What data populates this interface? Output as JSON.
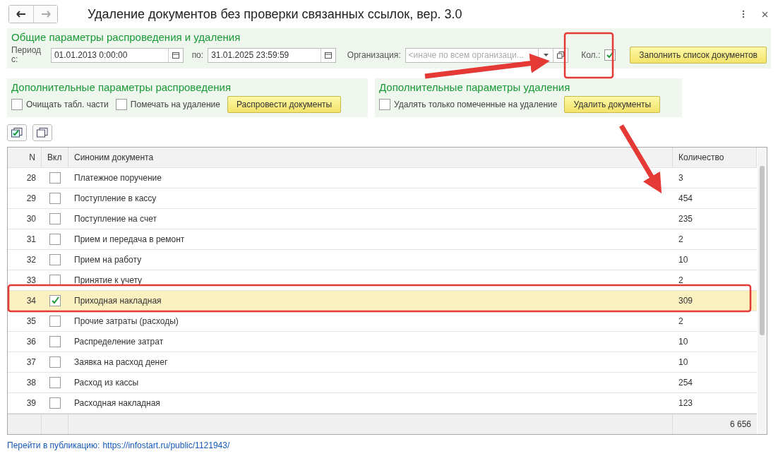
{
  "window": {
    "title": "Удаление документов без проверки связанных ссылок, вер. 3.0"
  },
  "general": {
    "title": "Общие параметры распроведения и удаления",
    "period_label": "Период с:",
    "date_from": "01.01.2013  0:00:00",
    "to_label": "по:",
    "date_to": "31.01.2025 23:59:59",
    "org_label": "Организация:",
    "org_placeholder": "<иначе по всем организаци...",
    "count_label": "Кол.:",
    "count_checked": true,
    "fill_button": "Заполнить список документов"
  },
  "repost": {
    "title": "Дополнительные параметры распроведения",
    "options": [
      {
        "label": "Очищать табл. части",
        "checked": false
      },
      {
        "label": "Помечать на удаление",
        "checked": false
      }
    ],
    "button": "Распровести документы"
  },
  "delete": {
    "title": "Дополнительные параметры удаления",
    "options": [
      {
        "label": "Удалять только помеченные на удаление",
        "checked": false
      }
    ],
    "button": "Удалить документы"
  },
  "table": {
    "columns": [
      "N",
      "Вкл",
      "Синоним документа",
      "Количество"
    ],
    "rows": [
      {
        "n": "28",
        "checked": false,
        "name": "Платежное поручение",
        "count": "3",
        "selected": false
      },
      {
        "n": "29",
        "checked": false,
        "name": "Поступление в кассу",
        "count": "454",
        "selected": false
      },
      {
        "n": "30",
        "checked": false,
        "name": "Поступление на счет",
        "count": "235",
        "selected": false
      },
      {
        "n": "31",
        "checked": false,
        "name": "Прием и передача в ремонт",
        "count": "2",
        "selected": false
      },
      {
        "n": "32",
        "checked": false,
        "name": "Прием на работу",
        "count": "10",
        "selected": false
      },
      {
        "n": "33",
        "checked": false,
        "name": "Принятие к учету",
        "count": "2",
        "selected": false
      },
      {
        "n": "34",
        "checked": true,
        "name": "Приходная накладная",
        "count": "309",
        "selected": true
      },
      {
        "n": "35",
        "checked": false,
        "name": "Прочие затраты (расходы)",
        "count": "2",
        "selected": false
      },
      {
        "n": "36",
        "checked": false,
        "name": "Распределение затрат",
        "count": "10",
        "selected": false
      },
      {
        "n": "37",
        "checked": false,
        "name": "Заявка на расход денег",
        "count": "10",
        "selected": false
      },
      {
        "n": "38",
        "checked": false,
        "name": "Расход из кассы",
        "count": "254",
        "selected": false
      },
      {
        "n": "39",
        "checked": false,
        "name": "Расходная накладная",
        "count": "123",
        "selected": false
      }
    ],
    "total": "6 656"
  },
  "link": {
    "label": "Перейти в публикацию:",
    "url": "https://infostart.ru/public/1121943/"
  }
}
